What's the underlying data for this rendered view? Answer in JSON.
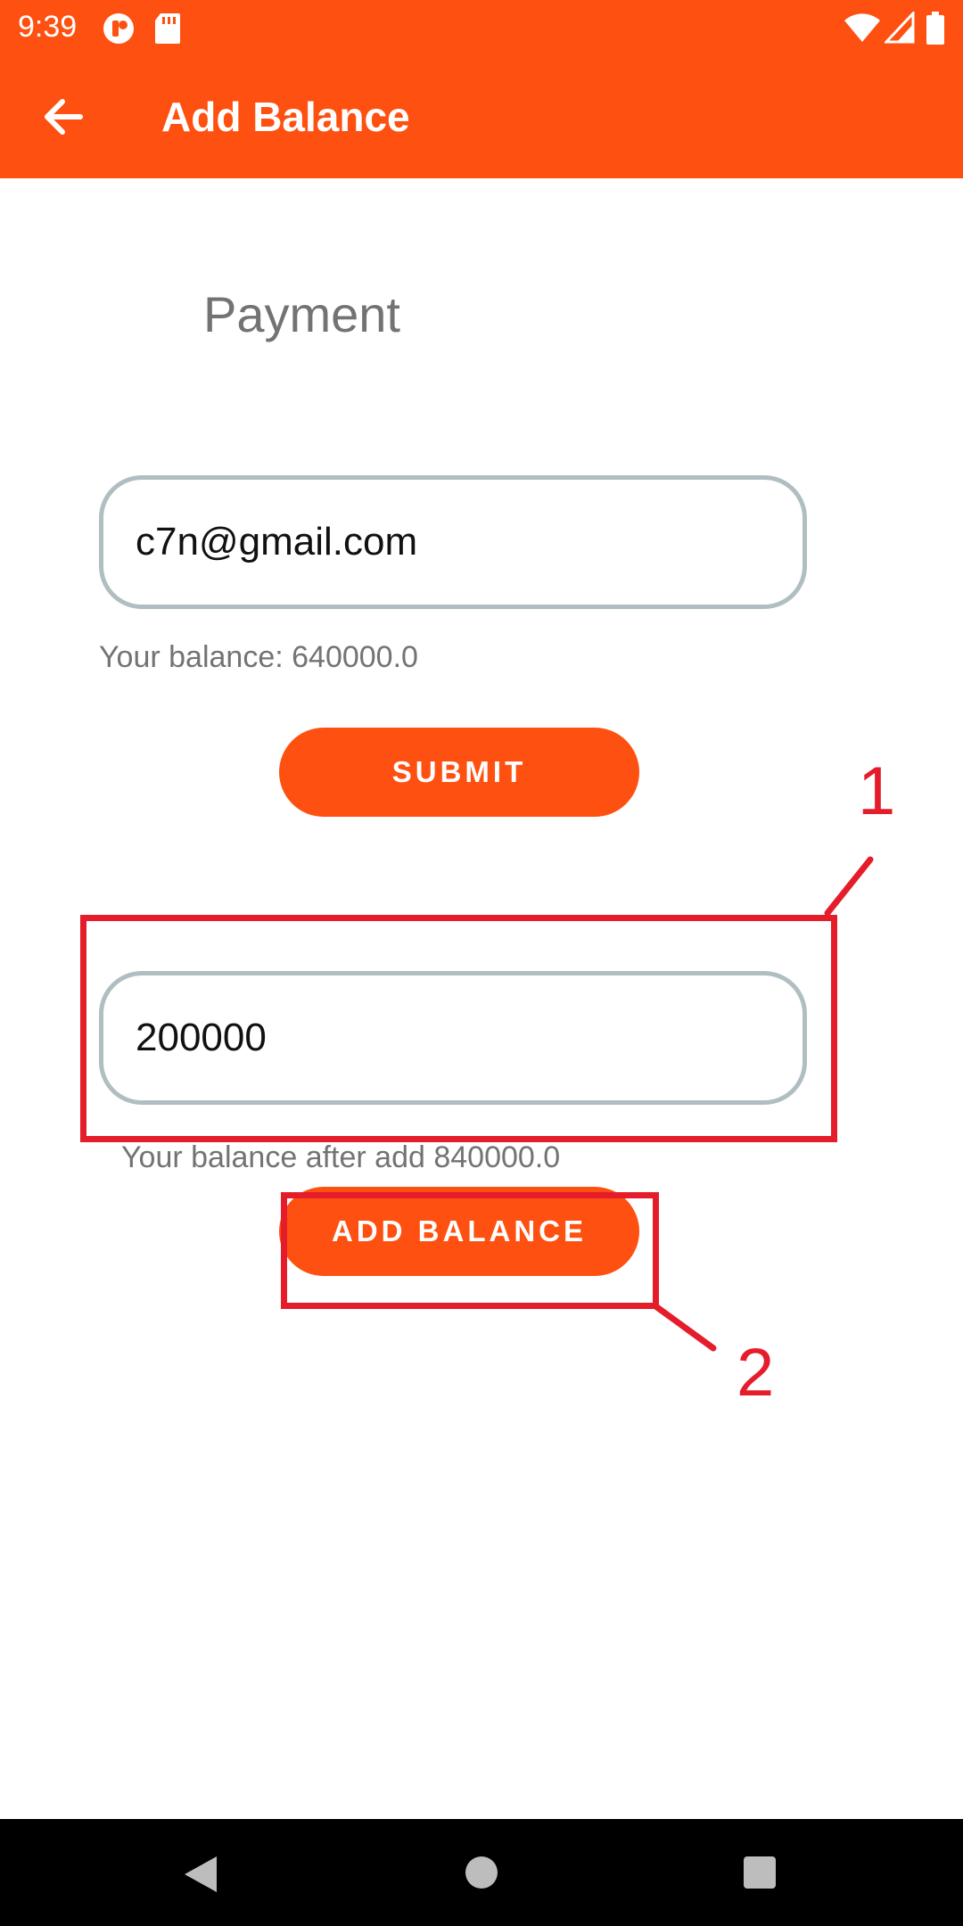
{
  "status_bar": {
    "time": "9:39"
  },
  "app_bar": {
    "title": "Add Balance",
    "accent_color": "#fe5010"
  },
  "payment": {
    "heading": "Payment",
    "email_value": "c7n@gmail.com",
    "balance_text": "Your balance: 640000.0",
    "submit_label": "SUBMIT"
  },
  "add_balance": {
    "amount_value": "200000",
    "after_text": "Your balance after add 840000.0",
    "button_label": "ADD BALANCE"
  },
  "annotations": {
    "label_1": "1",
    "label_2": "2",
    "color": "#e51d2b"
  },
  "icons": [
    "back-arrow-icon",
    "wifi-icon",
    "signal-icon",
    "battery-icon",
    "nav-back-icon",
    "nav-home-icon",
    "nav-recents-icon"
  ]
}
